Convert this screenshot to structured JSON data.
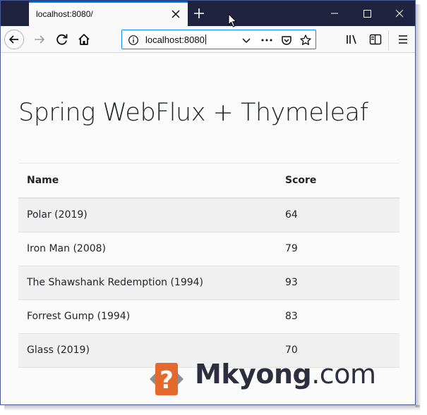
{
  "browser": {
    "tab_title": "localhost:8080/",
    "url": "localhost:8080",
    "accent_color": "#0a84ff",
    "titlebar_color": "#202340"
  },
  "page": {
    "heading": "Spring WebFlux + Thymeleaf",
    "table": {
      "columns": [
        "Name",
        "Score"
      ],
      "rows": [
        {
          "name": "Polar (2019)",
          "score": "64"
        },
        {
          "name": "Iron Man (2008)",
          "score": "79"
        },
        {
          "name": "The Shawshank Redemption (1994)",
          "score": "93"
        },
        {
          "name": "Forrest Gump (1994)",
          "score": "83"
        },
        {
          "name": "Glass (2019)",
          "score": "70"
        }
      ]
    }
  },
  "watermark": {
    "brand": "Mkyong",
    "suffix": ".com",
    "logo_color": "#e46a2b"
  },
  "icons": [
    "close-icon",
    "plus-icon",
    "minimize-icon",
    "maximize-icon",
    "back-arrow-icon",
    "forward-arrow-icon",
    "reload-icon",
    "home-icon",
    "info-icon",
    "chevron-down-icon",
    "more-dots-icon",
    "pocket-icon",
    "star-icon",
    "library-icon",
    "sidebar-icon",
    "hamburger-menu-icon"
  ]
}
